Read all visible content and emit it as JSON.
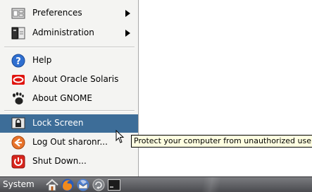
{
  "menu": {
    "items": [
      {
        "name": "menu-item-preferences",
        "label": "Preferences",
        "icon": "preferences-icon",
        "submenu": true
      },
      {
        "name": "menu-item-administration",
        "label": "Administration",
        "icon": "administration-icon",
        "submenu": true
      },
      {
        "name": "menu-item-help",
        "label": "Help",
        "icon": "help-icon"
      },
      {
        "name": "menu-item-about-oracle-solaris",
        "label": "About Oracle Solaris",
        "icon": "oracle-logo-icon"
      },
      {
        "name": "menu-item-about-gnome",
        "label": "About GNOME",
        "icon": "gnome-foot-icon"
      },
      {
        "name": "menu-item-lock-screen",
        "label": "Lock Screen",
        "icon": "lock-icon",
        "highlighted": true
      },
      {
        "name": "menu-item-log-out",
        "label": "Log Out sharonr...",
        "icon": "log-out-icon"
      },
      {
        "name": "menu-item-shut-down",
        "label": "Shut Down...",
        "icon": "power-icon"
      }
    ]
  },
  "tooltip": {
    "text": "Protect your computer from unauthorized use"
  },
  "panel": {
    "system_label": "System",
    "launchers": [
      "home-icon",
      "firefox-icon",
      "thunderbird-icon",
      "update-icon",
      "terminal-icon"
    ]
  },
  "colors": {
    "highlight": "#3d6d98",
    "tooltip_bg": "#ffffe1",
    "menu_bg": "#f4f4f2"
  }
}
